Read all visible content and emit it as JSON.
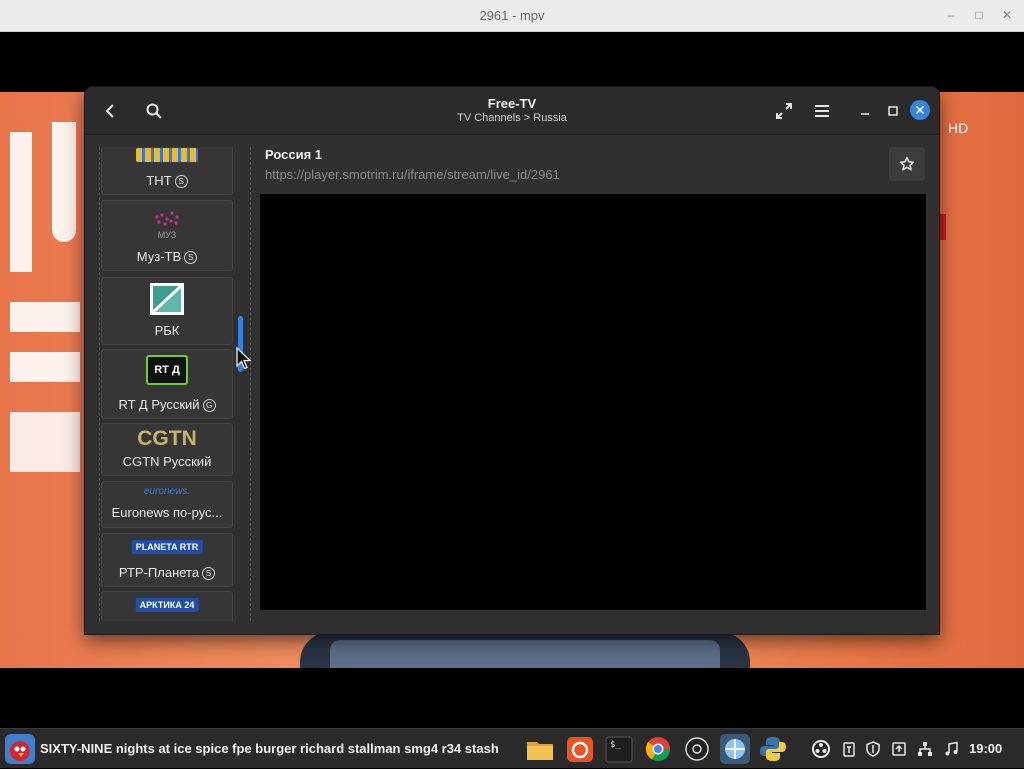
{
  "mpv": {
    "title": "2961 - mpv"
  },
  "video": {
    "badge": "HD"
  },
  "window": {
    "title": "Free-TV",
    "breadcrumb": "TV Channels > Russia"
  },
  "sidebar": {
    "channels": [
      {
        "label": "ТНТ",
        "badge": "S",
        "logo": "ТНТ"
      },
      {
        "label": "Муз-ТВ",
        "badge": "S",
        "logo": "МУЗ"
      },
      {
        "label": "РБК",
        "badge": "",
        "logo": "rbc-logo"
      },
      {
        "label": "RT Д Русский",
        "badge": "G",
        "logo": "RT Д"
      },
      {
        "label": "CGTN Русский",
        "badge": "",
        "logo": "CGTN"
      },
      {
        "label": "Euronews по-рус...",
        "badge": "",
        "logo": "euronews."
      },
      {
        "label": "РТР-Планета",
        "badge": "S",
        "logo": "PLANETA RTR"
      },
      {
        "label": "",
        "badge": "",
        "logo": "АРКТИКА 24"
      }
    ]
  },
  "detail": {
    "name": "Россия 1",
    "url": "https://player.smotrim.ru/iframe/stream/live_id/2961"
  },
  "taskbar": {
    "window_title": "SIXTY-NINE nights at ice spice fpe burger richard stallman smg4 r34 stash",
    "clock": "19:00",
    "apps": [
      "files-icon",
      "ubuntu-software-icon",
      "terminal-icon",
      "chrome-icon",
      "obs-like-icon",
      "freetv-icon",
      "python-icon"
    ],
    "tray": [
      "obs-icon",
      "clipboard-icon",
      "shield-icon",
      "upload-icon",
      "network-icon",
      "music-icon"
    ]
  },
  "colors": {
    "accent": "#3584e4",
    "window_bg": "#303030",
    "header_bg": "#2b2b2b",
    "cgtn_gold": "#c8b46a",
    "planeta_blue": "#1f4fa8",
    "rt_green": "#6fcf2a"
  }
}
